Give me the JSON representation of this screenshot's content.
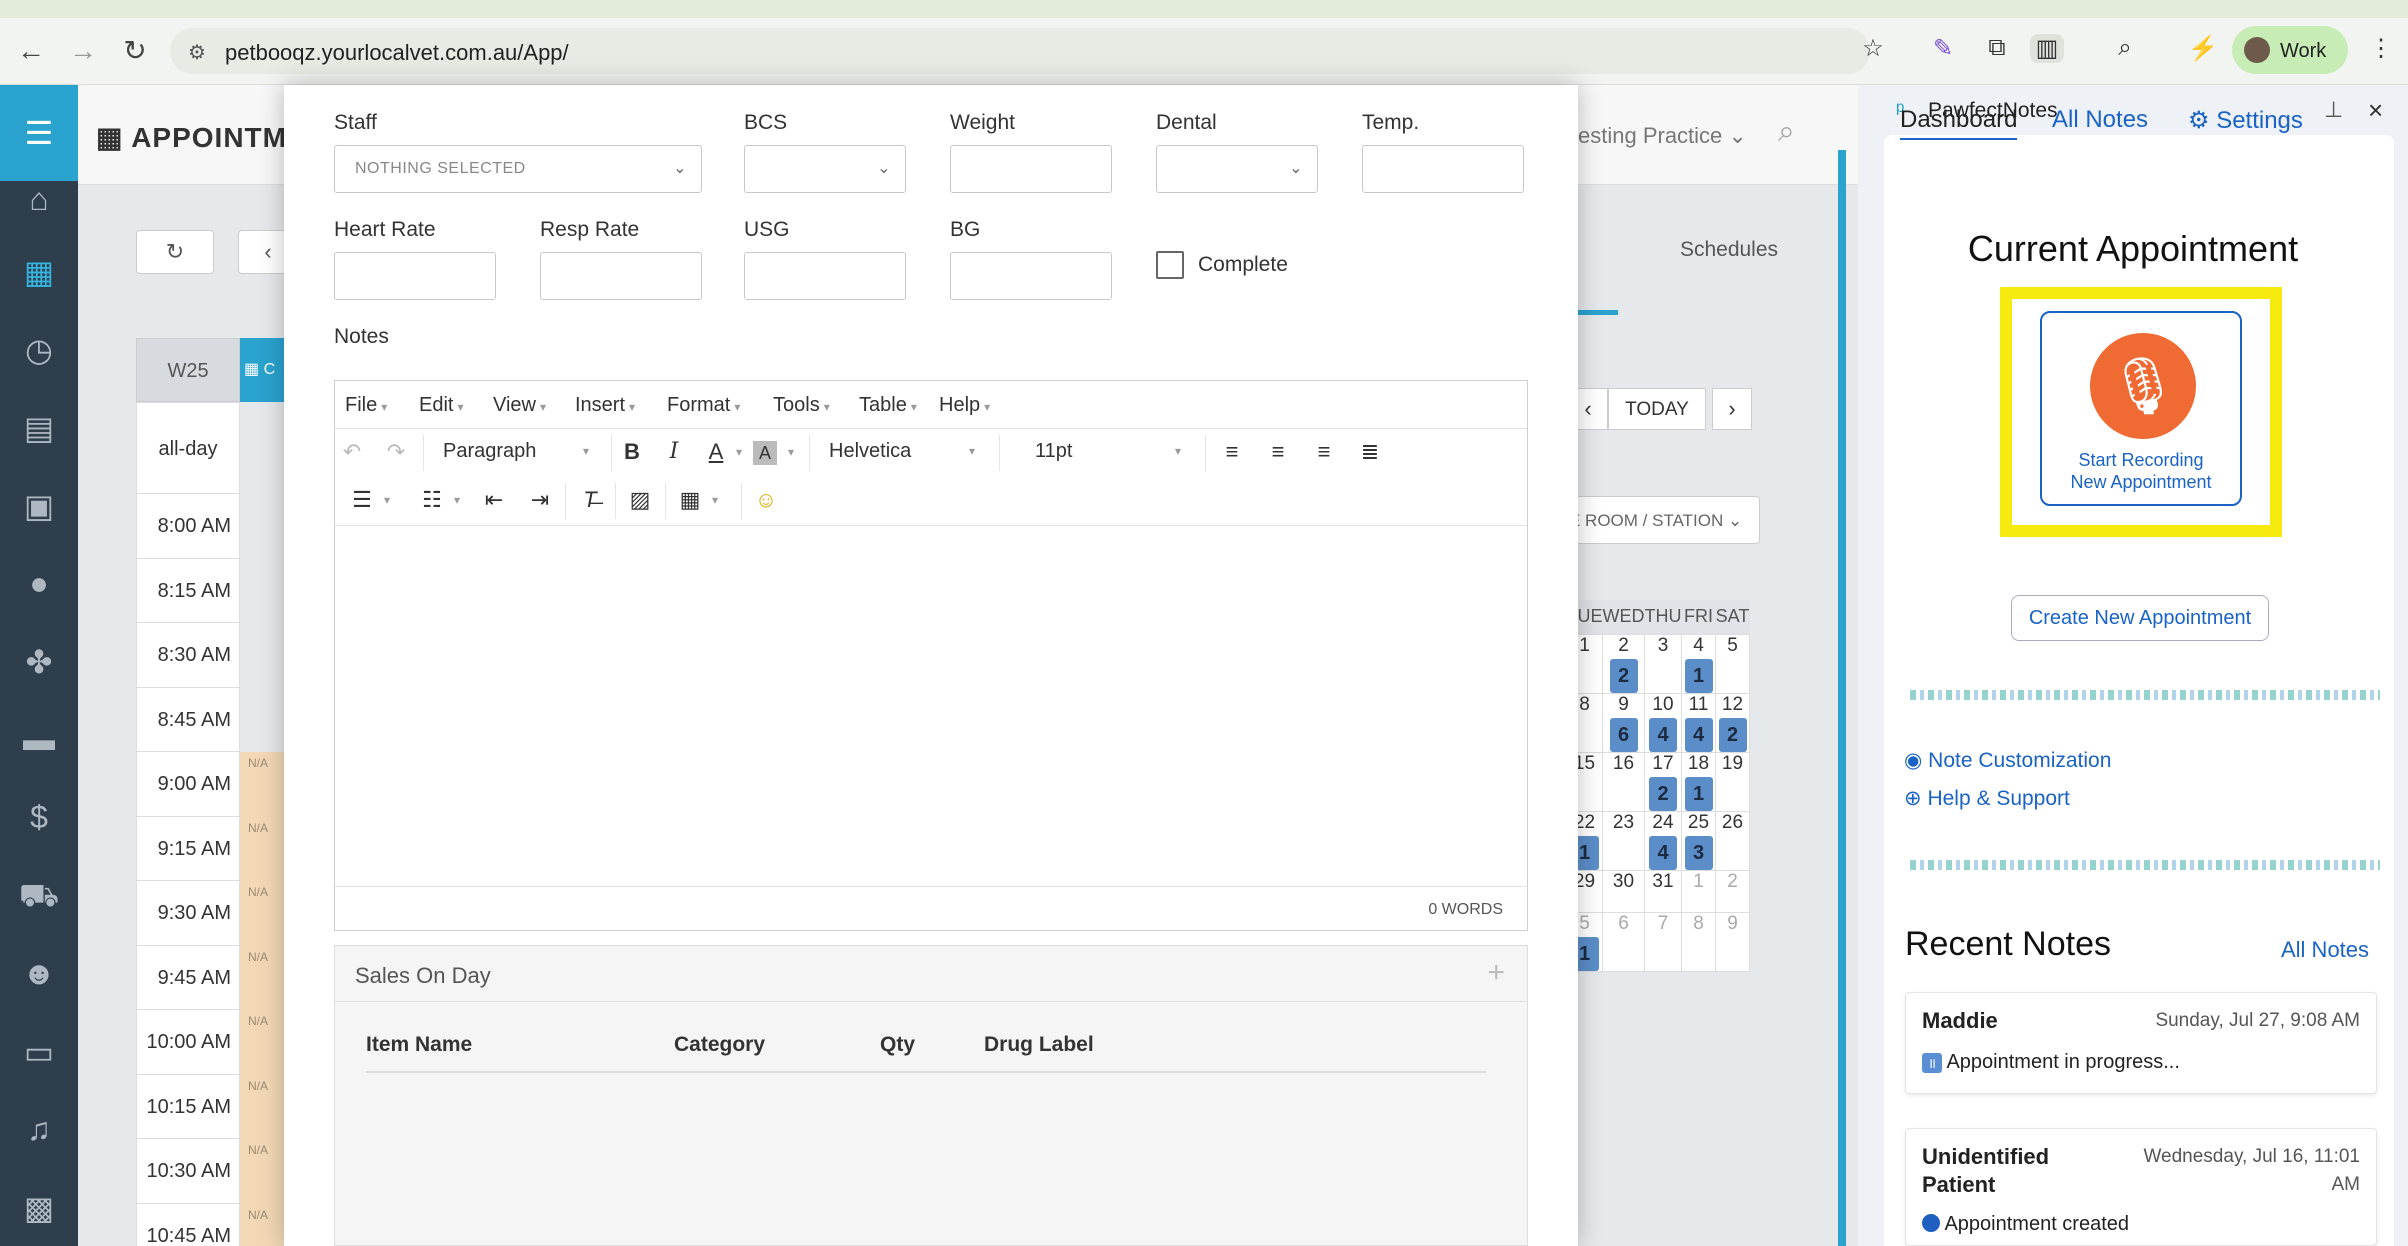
{
  "browser": {
    "url": "petbooqz.yourlocalvet.com.au/App/",
    "profile": "Work"
  },
  "app": {
    "title": "APPOINTME",
    "practice": "esting Practice",
    "week": "W25",
    "allday": "all-day",
    "times": [
      "8:00 AM",
      "8:15 AM",
      "8:30 AM",
      "8:45 AM",
      "9:00 AM",
      "9:15 AM",
      "9:30 AM",
      "9:45 AM",
      "10:00 AM",
      "10:15 AM",
      "10:30 AM",
      "10:45 AM"
    ],
    "na_label": "N/A",
    "schedules_tab": "Schedules",
    "today": "TODAY",
    "room_select": "E ROOM / STATION",
    "mini_cal": {
      "headers": [
        "TUE",
        "WED",
        "THU",
        "FRI",
        "SAT"
      ],
      "weeks": [
        {
          "days": [
            "1",
            "2",
            "3",
            "4",
            "5"
          ],
          "badges": [
            "",
            "2",
            "",
            "1",
            ""
          ]
        },
        {
          "days": [
            "8",
            "9",
            "10",
            "11",
            "12"
          ],
          "badges": [
            "",
            "6",
            "4",
            "4",
            "2"
          ]
        },
        {
          "days": [
            "15",
            "16",
            "17",
            "18",
            "19"
          ],
          "badges": [
            "",
            "",
            "2",
            "1",
            ""
          ]
        },
        {
          "days": [
            "22",
            "23",
            "24",
            "25",
            "26"
          ],
          "badges": [
            "1",
            "",
            "4",
            "3",
            ""
          ]
        },
        {
          "days": [
            "29",
            "30",
            "31",
            "1",
            "2"
          ],
          "badges": [
            "",
            "",
            "",
            "",
            ""
          ]
        },
        {
          "days": [
            "5",
            "6",
            "7",
            "8",
            "9"
          ],
          "badges": [
            "1",
            "",
            "",
            "",
            ""
          ]
        }
      ]
    }
  },
  "modal": {
    "fields": {
      "staff": {
        "label": "Staff",
        "value": "NOTHING SELECTED"
      },
      "bcs": {
        "label": "BCS"
      },
      "weight": {
        "label": "Weight"
      },
      "dental": {
        "label": "Dental"
      },
      "temp": {
        "label": "Temp."
      },
      "heart_rate": {
        "label": "Heart Rate"
      },
      "resp_rate": {
        "label": "Resp Rate"
      },
      "usg": {
        "label": "USG"
      },
      "bg": {
        "label": "BG"
      },
      "complete": {
        "label": "Complete"
      }
    },
    "notes_label": "Notes",
    "editor": {
      "menu": [
        "File",
        "Edit",
        "View",
        "Insert",
        "Format",
        "Tools",
        "Table",
        "Help"
      ],
      "block_format": "Paragraph",
      "font": "Helvetica",
      "size": "11pt",
      "word_count": "0 WORDS"
    },
    "sales": {
      "title": "Sales On Day",
      "columns": [
        "Item Name",
        "Category",
        "Qty",
        "Drug Label"
      ]
    }
  },
  "extension": {
    "name": "PawfectNotes",
    "tabs": [
      "Dashboard",
      "All Notes",
      "Settings"
    ],
    "current_title": "Current Appointment",
    "record_label_1": "Start Recording",
    "record_label_2": "New Appointment",
    "create_button": "Create New Appointment",
    "links": [
      "Note Customization",
      "Help & Support"
    ],
    "recent_title": "Recent Notes",
    "recent_all": "All Notes",
    "notes": [
      {
        "name": "Maddie",
        "date": "Sunday, Jul 27, 9:08 AM",
        "status": "Appointment in progress..."
      },
      {
        "name_1": "Unidentified",
        "name_2": "Patient",
        "date_1": "Wednesday, Jul 16, 11:01",
        "date_2": "AM",
        "status": "Appointment created"
      }
    ],
    "colors": {
      "accent": "#1a63c6",
      "highlight": "#f7ea0e",
      "mic": "#f06a34"
    }
  }
}
